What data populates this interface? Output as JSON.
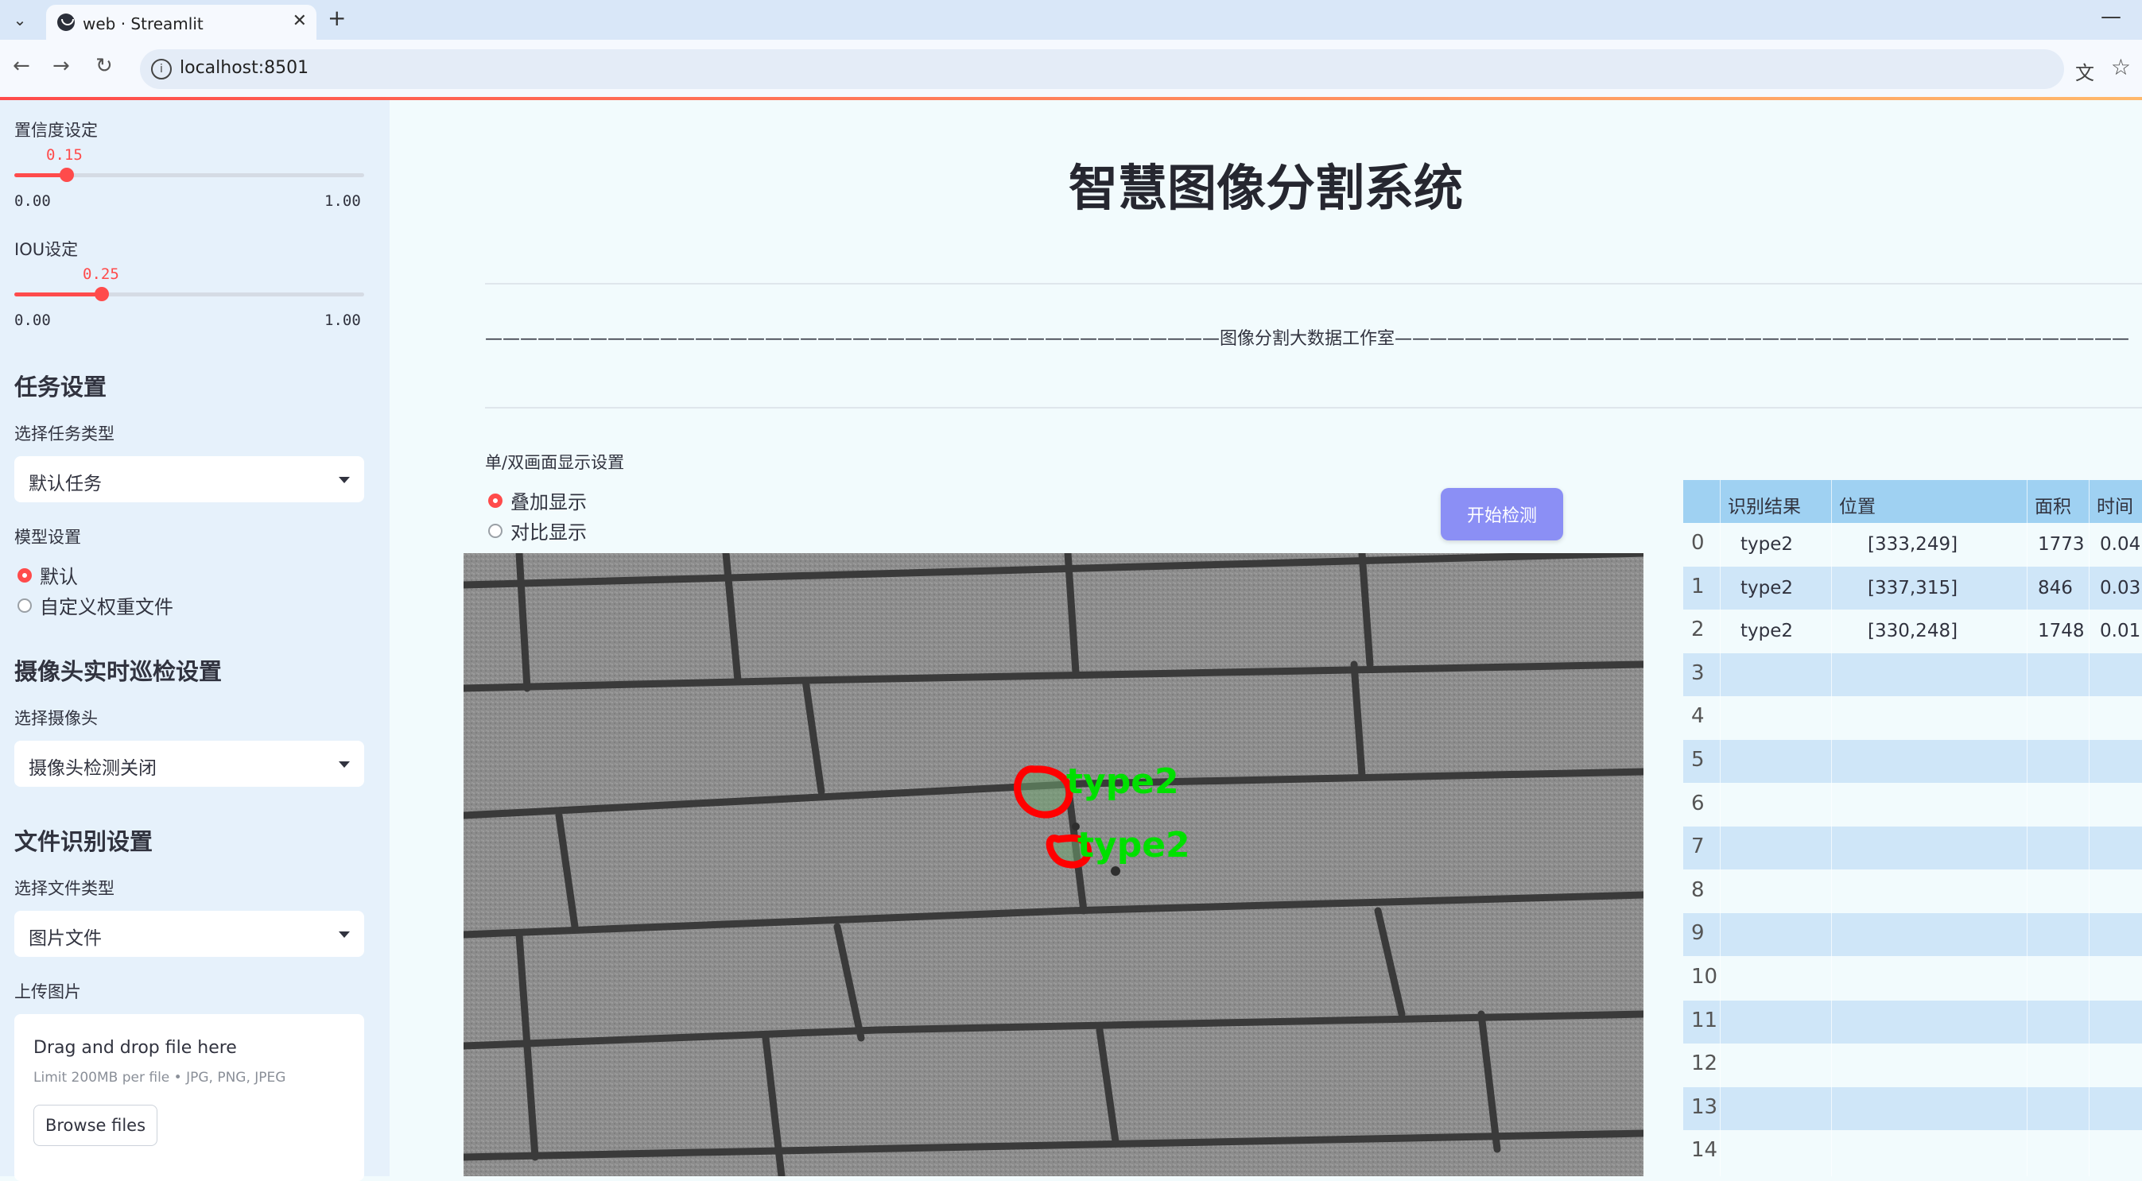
{
  "browser": {
    "tab_title": "web · Streamlit",
    "url": "localhost:8501",
    "icons": [
      "chevron-down-icon",
      "close-icon",
      "plus-icon",
      "back-icon",
      "forward-icon",
      "reload-icon",
      "info-icon",
      "translate-icon",
      "star-icon",
      "minimize-icon"
    ]
  },
  "sidebar": {
    "confidence": {
      "label": "置信度设定",
      "value": "0.15",
      "fraction": 0.15,
      "min": "0.00",
      "max": "1.00"
    },
    "iou": {
      "label": "IOU设定",
      "value": "0.25",
      "fraction": 0.25,
      "min": "0.00",
      "max": "1.00"
    },
    "task_heading": "任务设置",
    "task_label": "选择任务类型",
    "task_value": "默认任务",
    "model_label": "模型设置",
    "model_options": [
      "默认",
      "自定义权重文件"
    ],
    "model_selected": "默认",
    "camera_heading": "摄像头实时巡检设置",
    "camera_label": "选择摄像头",
    "camera_value": "摄像头检测关闭",
    "file_heading": "文件识别设置",
    "file_type_label": "选择文件类型",
    "file_type_value": "图片文件",
    "upload_label": "上传图片",
    "upload_title": "Drag and drop file here",
    "upload_hint": "Limit 200MB per file • JPG, PNG, JPEG",
    "browse_label": "Browse files"
  },
  "main": {
    "title": "智慧图像分割系统",
    "subtitle": "——————————————————————————————————————————图像分割大数据工作室——————————————————————————————————————————",
    "display_mode_label": "单/双画面显示设置",
    "display_options": [
      "叠加显示",
      "对比显示"
    ],
    "display_selected": "叠加显示",
    "start_button": "开始检测",
    "detections": [
      {
        "label": "type2"
      },
      {
        "label": "type2"
      }
    ]
  },
  "colors": {
    "accent": "#ff4b4b",
    "button": "#8b8ff5",
    "table_header": "#9fd1f2",
    "table_stripe": "#cfe6f8",
    "mask_outline": "#ff0000",
    "label_text": "#00e000"
  },
  "table": {
    "headers": [
      "",
      "识别结果",
      "位置",
      "面积",
      "时间"
    ],
    "rows": [
      [
        "0",
        "type2",
        "[333,249]",
        "1773",
        "0.04"
      ],
      [
        "1",
        "type2",
        "[337,315]",
        "846",
        "0.03"
      ],
      [
        "2",
        "type2",
        "[330,248]",
        "1748",
        "0.01"
      ],
      [
        "3",
        "",
        "",
        "",
        ""
      ],
      [
        "4",
        "",
        "",
        "",
        ""
      ],
      [
        "5",
        "",
        "",
        "",
        ""
      ],
      [
        "6",
        "",
        "",
        "",
        ""
      ],
      [
        "7",
        "",
        "",
        "",
        ""
      ],
      [
        "8",
        "",
        "",
        "",
        ""
      ],
      [
        "9",
        "",
        "",
        "",
        ""
      ],
      [
        "10",
        "",
        "",
        "",
        ""
      ],
      [
        "11",
        "",
        "",
        "",
        ""
      ],
      [
        "12",
        "",
        "",
        "",
        ""
      ],
      [
        "13",
        "",
        "",
        "",
        ""
      ],
      [
        "14",
        "",
        "",
        "",
        ""
      ]
    ]
  }
}
